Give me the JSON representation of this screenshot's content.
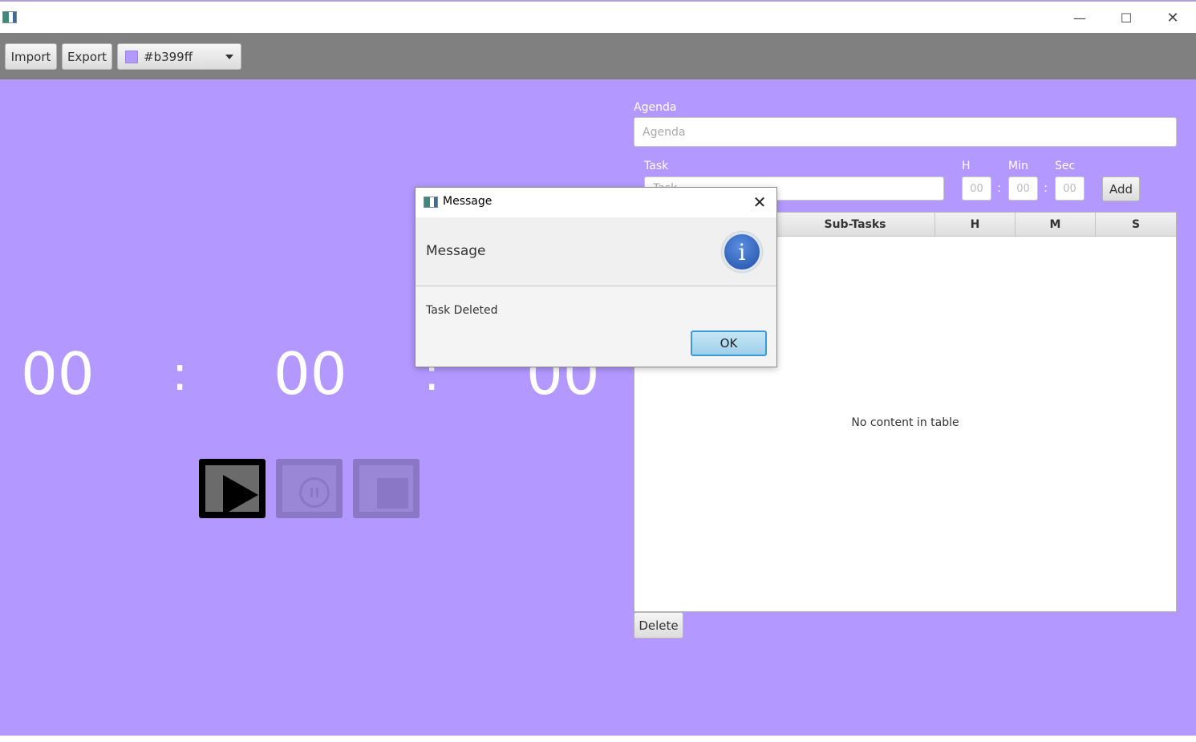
{
  "window": {
    "controls": {
      "minimize": "—",
      "maximize": "☐",
      "close": "✕"
    }
  },
  "toolbar": {
    "import_label": "Import",
    "export_label": "Export",
    "color_value": "#b399ff"
  },
  "timer": {
    "hours": "00",
    "minutes": "00",
    "seconds": "00",
    "separator": ":"
  },
  "controls": {
    "play_state": "enabled",
    "pause_state": "disabled",
    "stop_state": "disabled"
  },
  "agenda": {
    "label": "Agenda",
    "placeholder": "Agenda",
    "value": ""
  },
  "task_form": {
    "task_label": "Task",
    "task_placeholder": "Task",
    "h_label": "H",
    "min_label": "Min",
    "sec_label": "Sec",
    "h_placeholder": "00",
    "min_placeholder": "00",
    "sec_placeholder": "00",
    "separator": ":",
    "add_label": "Add"
  },
  "table": {
    "columns": [
      "",
      "Sub-Tasks",
      "H",
      "M",
      "S"
    ],
    "rows": [],
    "empty_text": "No content in table"
  },
  "delete_label": "Delete",
  "dialog": {
    "title": "Message",
    "header": "Message",
    "icon": "information-icon",
    "icon_glyph": "i",
    "content": "Task Deleted",
    "ok_label": "OK",
    "close_glyph": "✕"
  },
  "colors": {
    "background": "#b399ff",
    "toolbar": "#808080",
    "dialog_ok_border": "#3b9ad6"
  }
}
